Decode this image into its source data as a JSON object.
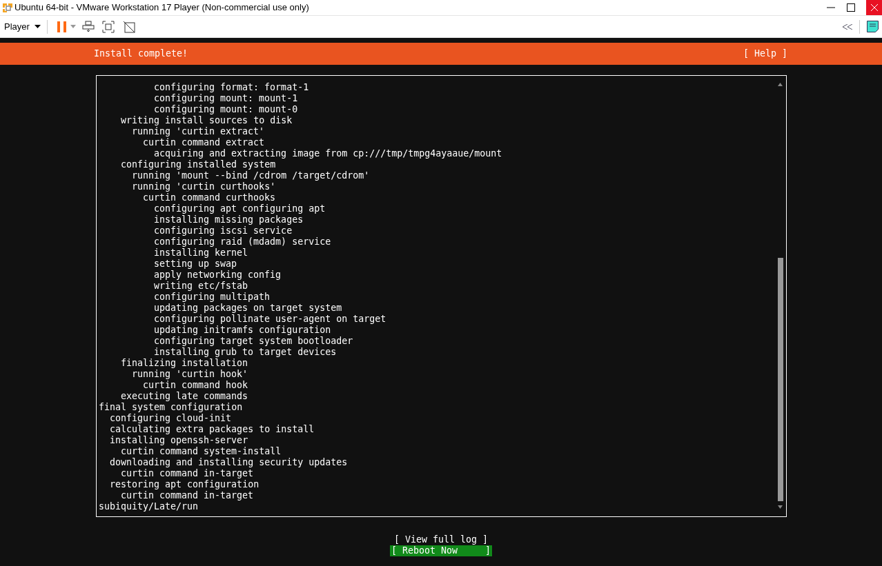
{
  "window": {
    "title": "Ubuntu 64-bit - VMware Workstation 17 Player (Non-commercial use only)"
  },
  "toolbar": {
    "menu": "Player"
  },
  "header": {
    "title": "Install complete!",
    "help": "[ Help ]"
  },
  "log": [
    {
      "children": [
        {
          "children": [
            {
              "children": [
                {
                  "children": [
                    {
                      "children": [
                        {
                          "text": "configuring format: format-1"
                        },
                        {
                          "text": "configuring mount: mount-1"
                        },
                        {
                          "text": "configuring mount: mount-0"
                        }
                      ]
                    }
                  ]
                }
              ]
            },
            {
              "text": "writing install sources to disk",
              "children": [
                {
                  "text": "running 'curtin extract'",
                  "children": [
                    {
                      "text": "curtin command extract",
                      "children": [
                        {
                          "text": "acquiring and extracting image from cp:///tmp/tmpg4ayaaue/mount"
                        }
                      ]
                    }
                  ]
                }
              ]
            },
            {
              "text": "configuring installed system",
              "children": [
                {
                  "text": "running 'mount --bind /cdrom /target/cdrom'"
                },
                {
                  "text": "running 'curtin curthooks'",
                  "children": [
                    {
                      "text": "curtin command curthooks",
                      "children": [
                        {
                          "text": "configuring apt configuring apt"
                        },
                        {
                          "text": "installing missing packages"
                        },
                        {
                          "text": "configuring iscsi service"
                        },
                        {
                          "text": "configuring raid (mdadm) service"
                        },
                        {
                          "text": "installing kernel"
                        },
                        {
                          "text": "setting up swap"
                        },
                        {
                          "text": "apply networking config"
                        },
                        {
                          "text": "writing etc/fstab"
                        },
                        {
                          "text": "configuring multipath"
                        },
                        {
                          "text": "updating packages on target system"
                        },
                        {
                          "text": "configuring pollinate user-agent on target"
                        },
                        {
                          "text": "updating initramfs configuration"
                        },
                        {
                          "text": "configuring target system bootloader"
                        },
                        {
                          "text": "installing grub to target devices"
                        }
                      ]
                    }
                  ]
                }
              ]
            },
            {
              "text": "finalizing installation",
              "children": [
                {
                  "text": "running 'curtin hook'",
                  "children": [
                    {
                      "text": "curtin command hook"
                    }
                  ]
                }
              ]
            },
            {
              "text": "executing late commands"
            }
          ]
        }
      ]
    },
    {
      "text": "final system configuration",
      "children": [
        {
          "text": "configuring cloud-init"
        },
        {
          "text": "calculating extra packages to install"
        },
        {
          "text": "installing openssh-server",
          "children": [
            {
              "text": "curtin command system-install"
            }
          ]
        },
        {
          "text": "downloading and installing security updates",
          "children": [
            {
              "text": "curtin command in-target"
            }
          ]
        },
        {
          "text": "restoring apt configuration",
          "children": [
            {
              "text": "curtin command in-target"
            }
          ]
        }
      ]
    },
    {
      "text": "subiquity/Late/run"
    }
  ],
  "buttons": [
    {
      "label": "[ View full log ]",
      "selected": false
    },
    {
      "label": "[ Reboot Now     ]",
      "selected": true
    }
  ]
}
